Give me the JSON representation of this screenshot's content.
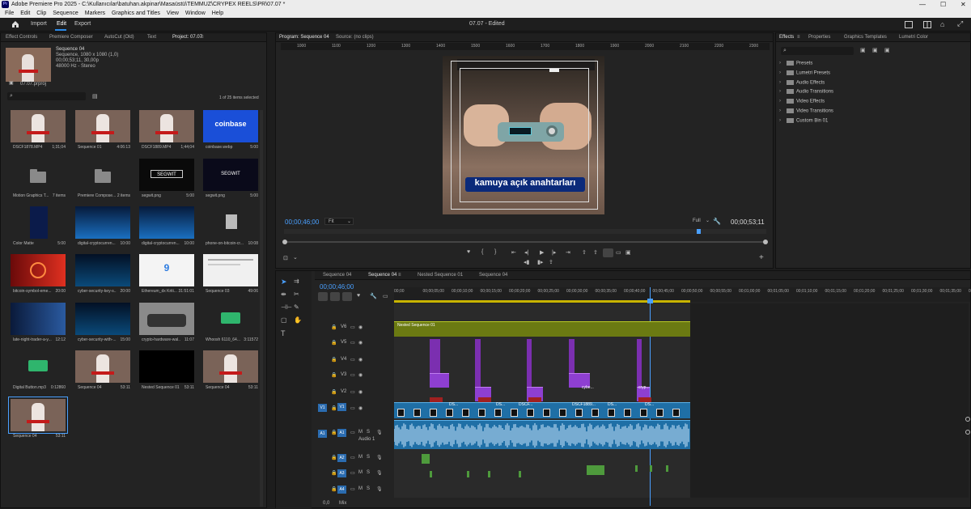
{
  "window": {
    "title": "Adobe Premiere Pro 2025 - C:\\Kullanıcılar\\batuhan.akpinar\\Masaüstü\\TEMMUZ\\CRYPEX REELS\\PR\\07.07 *"
  },
  "menu": [
    "File",
    "Edit",
    "Clip",
    "Sequence",
    "Markers",
    "Graphics and Titles",
    "View",
    "Window",
    "Help"
  ],
  "workspace": {
    "tabs": [
      "Import",
      "Edit",
      "Export"
    ],
    "active": "Edit",
    "doc_title": "07.07 - Edited"
  },
  "project": {
    "tabs": [
      "Effect Controls",
      "Premiere Composer",
      "AutoCut (Old)",
      "Text",
      "Project: 07.07"
    ],
    "active_tab": "Project: 07.07",
    "seq_info": {
      "name": "Sequence 04",
      "line1": "Sequence, 1080 x 1080 (1,0)",
      "line2": "00;00;53;11, 30,00p",
      "line3": "48000 Hz - Stereo"
    },
    "file": "07.07.prproj",
    "search_placeholder": "",
    "items_selected": "1 of 25 items selected",
    "items": [
      {
        "name": "DSCF1878.MP4",
        "dur": "1;31;04",
        "kind": "person"
      },
      {
        "name": "Sequence 01",
        "dur": "4:06:13",
        "kind": "person"
      },
      {
        "name": "DSCF1889.MP4",
        "dur": "1;44;04",
        "kind": "person"
      },
      {
        "name": "coinbase.webp",
        "dur": "5:00",
        "kind": "coinbase",
        "label": "coinbase"
      },
      {
        "name": "Motion Graphics T...",
        "dur": "7 items",
        "kind": "folder"
      },
      {
        "name": "Premiere Compose...",
        "dur": "2 items",
        "kind": "folder"
      },
      {
        "name": "segwit.png",
        "dur": "5:00",
        "kind": "segwit",
        "label": "SEGWIT"
      },
      {
        "name": "segwit.png",
        "dur": "5:00",
        "kind": "segwit2",
        "label": "SEGWIT"
      },
      {
        "name": "Color Matte",
        "dur": "5:00",
        "kind": "matte"
      },
      {
        "name": "digital-cryptocurren...",
        "dur": "10:00",
        "kind": "cryptoblue"
      },
      {
        "name": "digital-cryptocurren...",
        "dur": "10:00",
        "kind": "cryptoblue"
      },
      {
        "name": "phone-on-bitcoin-cr...",
        "dur": "10:08",
        "kind": "file"
      },
      {
        "name": "bitcoin-symbol-eme...",
        "dur": "20:00",
        "kind": "bitcoin"
      },
      {
        "name": "cyber-security-key-s...",
        "dur": "20:00",
        "kind": "cyber"
      },
      {
        "name": "Ethereum_dx Kriti...",
        "dur": "31:51:01",
        "kind": "white",
        "label": "9"
      },
      {
        "name": "Sequence 03",
        "dur": "49:06",
        "kind": "doc"
      },
      {
        "name": "late-night-trader-a-y...",
        "dur": "12:12",
        "kind": "trader"
      },
      {
        "name": "cyber-security-with-...",
        "dur": "15:00",
        "kind": "cyber"
      },
      {
        "name": "crypto-hardware-wal...",
        "dur": "11:07",
        "kind": "hands"
      },
      {
        "name": "Whoosh 6110_64...",
        "dur": "3:11572",
        "kind": "audio"
      },
      {
        "name": "Digital Button.mp3",
        "dur": "0:12860",
        "kind": "audio"
      },
      {
        "name": "Sequence 04",
        "dur": "53:11",
        "kind": "person"
      },
      {
        "name": "Nested Sequence 01",
        "dur": "53:11",
        "kind": "black"
      },
      {
        "name": "Sequence 04",
        "dur": "53:11",
        "kind": "person"
      },
      {
        "name": "Sequence 04",
        "dur": "53:11",
        "kind": "person"
      }
    ]
  },
  "program": {
    "tabs": [
      "Program: Sequence 04",
      "Source: (no clips)"
    ],
    "ruler_ticks": [
      "1000",
      "1100",
      "1200",
      "1300",
      "1400",
      "1500",
      "1600",
      "1700",
      "1800",
      "1900",
      "2000",
      "2100",
      "2200",
      "2300"
    ],
    "caption": "kamuya açık anahtarları",
    "timecode": "00;00;46;00",
    "fit": "Fit",
    "quality": "Full",
    "duration": "00;00;53;11"
  },
  "effects": {
    "tabs": [
      "Effects",
      "Properties",
      "Graphics Templates",
      "Lumetri Color"
    ],
    "items": [
      "Presets",
      "Lumetri Presets",
      "Audio Effects",
      "Audio Transitions",
      "Video Effects",
      "Video Transitions",
      "Custom Bin 01"
    ]
  },
  "timeline": {
    "tabs": [
      "Sequence 04",
      "Sequence 04",
      "Nested Sequence 01",
      "Sequence 04"
    ],
    "active_tab_index": 1,
    "timecode": "00;00;46;00",
    "ruler": [
      "00;00",
      "00;00;05;00",
      "00;00;10;00",
      "00;00;15;00",
      "00;00;20;00",
      "00;00;25;00",
      "00;00;30;00",
      "00;00;35;00",
      "00;00;40;00",
      "00;00;45;00",
      "00;00;50;00",
      "00;00;55;00",
      "00;01;00;00",
      "00;01;05;00",
      "00;01;10;00",
      "00;01;15;00",
      "00;01;20;00",
      "00;01;25;00",
      "00;01;30;00",
      "00;01;35;00",
      "00;01;40;00"
    ],
    "video_tracks": [
      "V6",
      "V5",
      "V4",
      "V3",
      "V2",
      "V1"
    ],
    "audio_tracks": [
      "A1",
      "A2",
      "A3",
      "A4"
    ],
    "audio1_name": "Audio 1",
    "nested_clip": "Nested Sequence 01",
    "v1_clips": [
      "DS...",
      "DS...",
      "DSCF...",
      "DSCF1889...",
      "DS...",
      "DS..."
    ],
    "v2_clips": [
      "cybe...",
      "cryp..."
    ],
    "mix": {
      "label": "Mix",
      "value": "0,0"
    }
  }
}
